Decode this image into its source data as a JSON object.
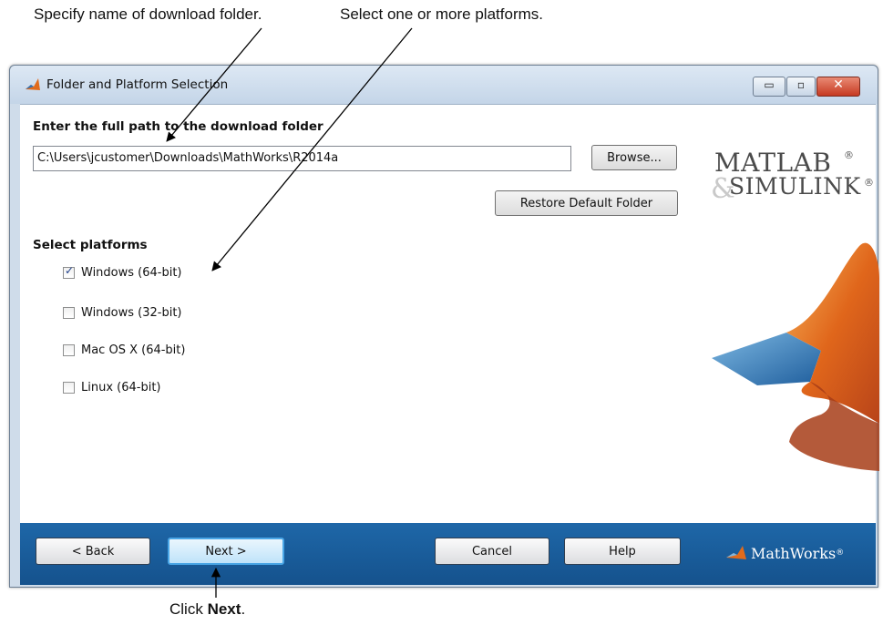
{
  "annotations": {
    "folder": "Specify name of download folder.",
    "platforms": "Select one or more platforms.",
    "next_prefix": "Click",
    "next_bold": "Next",
    "next_suffix": "."
  },
  "window": {
    "title": "Folder and Platform Selection",
    "controls": {
      "minimize": "▭",
      "maximize": "▫",
      "close": "✕"
    }
  },
  "download_folder": {
    "label": "Enter the full path to the download folder",
    "value": "C:\\Users\\jcustomer\\Downloads\\MathWorks\\R2014a",
    "browse_label": "Browse...",
    "restore_label": "Restore Default Folder"
  },
  "platforms": {
    "label": "Select platforms",
    "items": [
      {
        "label": "Windows (64-bit)",
        "checked": true
      },
      {
        "label": "Windows (32-bit)",
        "checked": false
      },
      {
        "label": "Mac OS X (64-bit)",
        "checked": false
      },
      {
        "label": "Linux (64-bit)",
        "checked": false
      }
    ]
  },
  "branding": {
    "matlab": "MATLAB",
    "simulink": "SIMULINK",
    "ampersand": "&",
    "registered": "®",
    "mathworks": "MathWorks",
    "trademark": "®"
  },
  "footer": {
    "back_label": "< Back",
    "next_label": "Next >",
    "cancel_label": "Cancel",
    "help_label": "Help"
  },
  "colors": {
    "footer_blue": "#1a5d9b",
    "next_highlight": "#4aa6e6",
    "close_red": "#c63a22",
    "matlab_orange": "#e16b1c"
  }
}
